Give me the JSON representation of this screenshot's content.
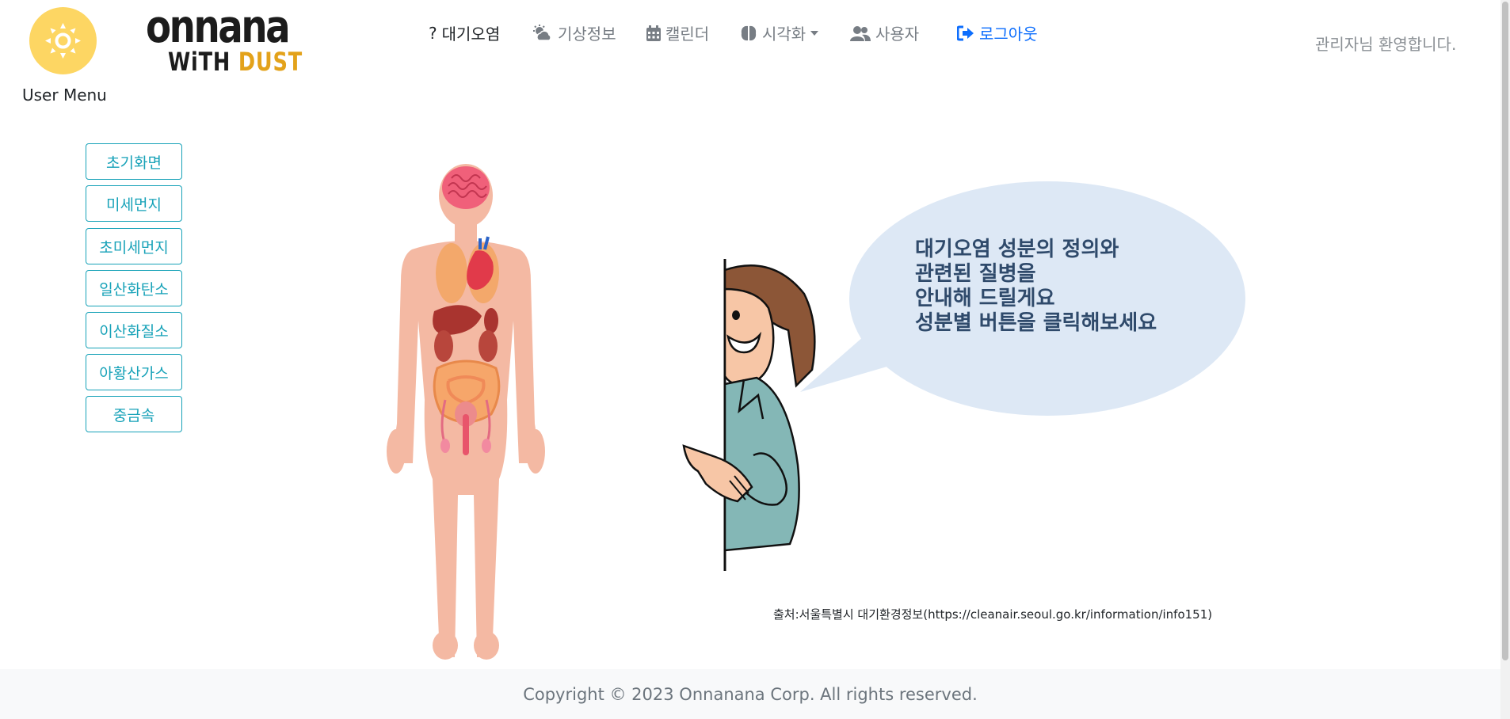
{
  "user_menu": {
    "label": "User Menu",
    "avatar_color": "#fdd663"
  },
  "logo": {
    "line1": "onnana",
    "line2_a": "WiTH ",
    "line2_b": "DUST",
    "accent_color": "#e3a21a"
  },
  "nav": {
    "items": [
      {
        "label": "대기오염",
        "icon": "question-icon",
        "active": true
      },
      {
        "label": "기상정보",
        "icon": "cloud-sun-icon"
      },
      {
        "label": "캘린더",
        "icon": "calendar-icon"
      },
      {
        "label": "시각화",
        "icon": "brain-icon",
        "dropdown": true
      },
      {
        "label": "사용자",
        "icon": "users-icon"
      },
      {
        "label": "로그아웃",
        "icon": "sign-out-icon"
      }
    ],
    "welcome": "관리자님 환영합니다."
  },
  "sidebar": {
    "buttons": [
      "초기화면",
      "미세먼지",
      "초미세먼지",
      "일산화탄소",
      "이산화질소",
      "아황산가스",
      "중금속"
    ],
    "accent_color": "#17a2b8"
  },
  "bubble": {
    "text": "대기오염 성분의 정의와\n관련된 질병을\n안내해 드릴게요\n성분별 버튼을 클릭해보세요",
    "color": "#dde8f5"
  },
  "source": "출처:서울특별시 대기환경정보(https://cleanair.seoul.go.kr/information/info151)",
  "footer": {
    "copyright": "Copyright © 2023 Onnanana Corp. All rights reserved."
  }
}
